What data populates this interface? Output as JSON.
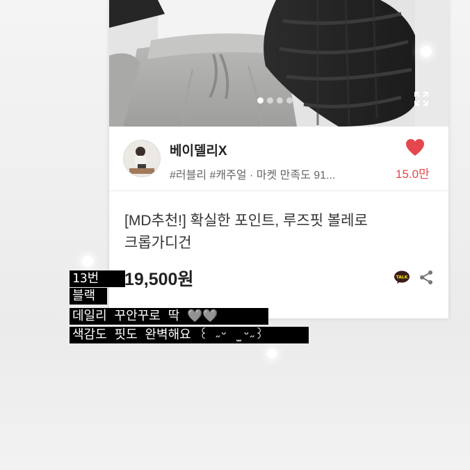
{
  "product": {
    "seller_name": "베이델리X",
    "seller_tags": "#러블리 #캐주얼 · 마켓 만족도 91...",
    "like_count": "15.0만",
    "title_line1": "[MD추천!] 확실한 포인트, 루즈핏 볼레로",
    "title_line2": "크롭가디건",
    "price": "19,500원",
    "image_page_indicator": {
      "total": 4,
      "active": 1
    },
    "heart_color": "#e4474e"
  },
  "icons": {
    "heart": "heart-icon",
    "expand": "expand-icon",
    "kakaotalk": "kakaotalk-icon",
    "share": "share-icon"
  },
  "overlay": {
    "line1": "13번",
    "line2": "블랙",
    "line3": "데일리 꾸안꾸로 딱 🩶🩶",
    "line4": "색감도 핏도 완벽해요 ꒰ ˶ᵕ ̫ ᵕ˶꒱"
  }
}
